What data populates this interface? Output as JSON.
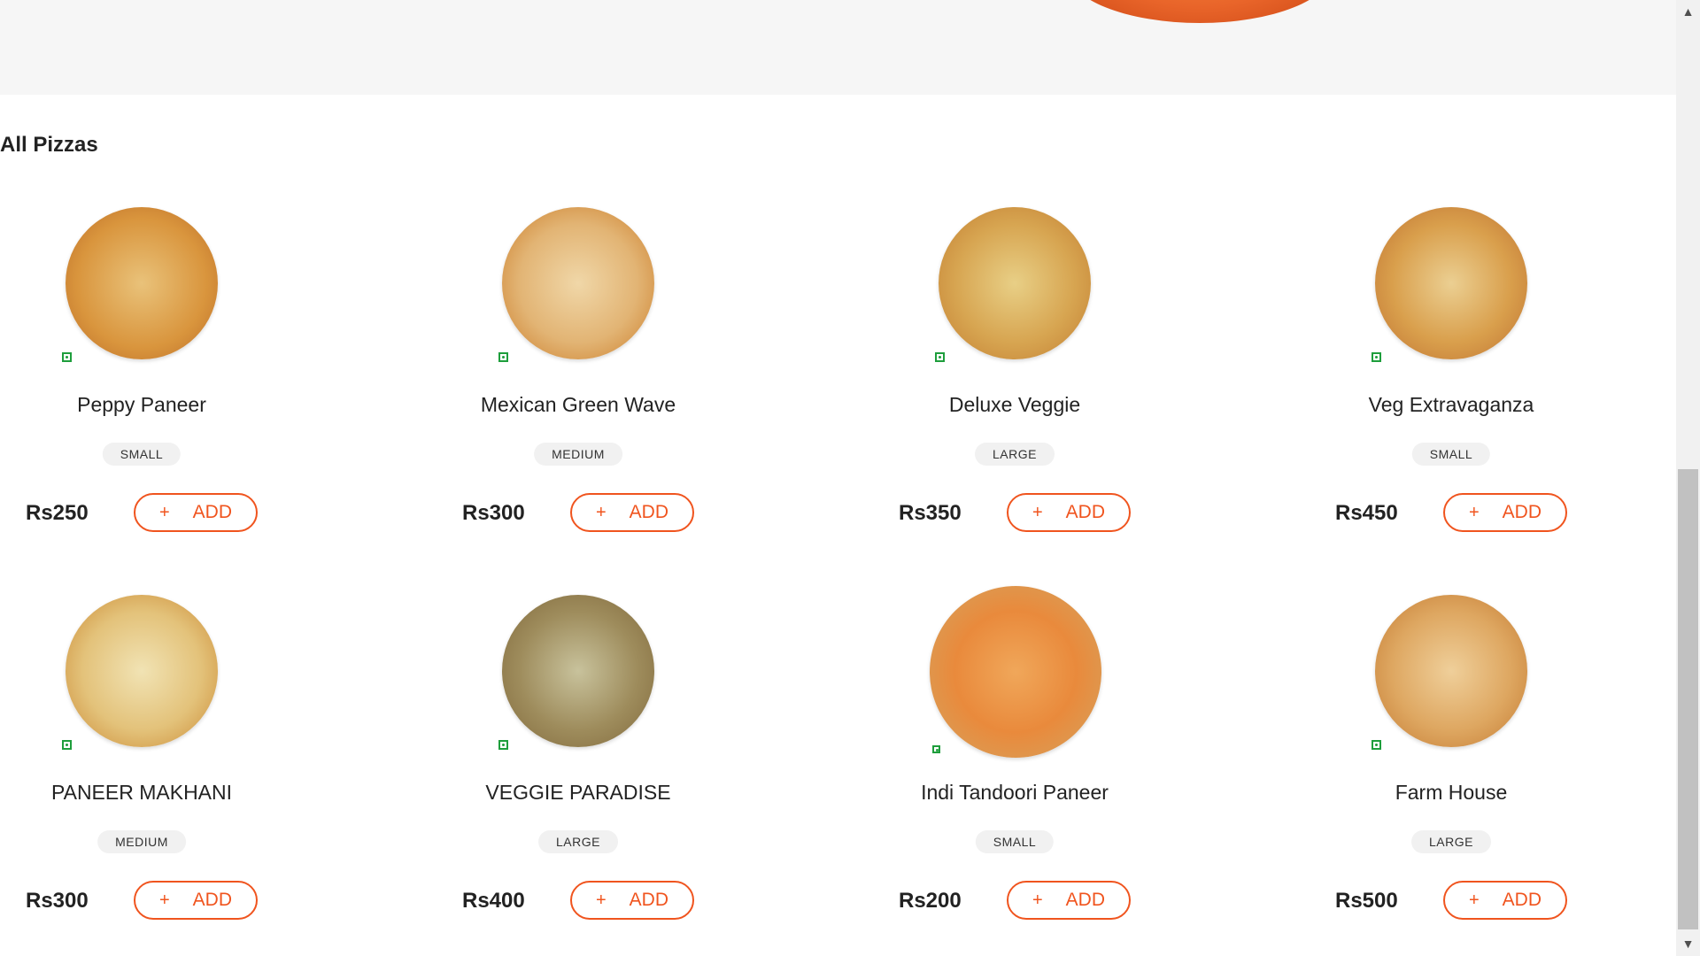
{
  "section_title": "All Pizzas",
  "veg_color": "#1e9e3c",
  "accent_color": "#f0541e",
  "pizzas": [
    {
      "name": "Peppy Paneer",
      "size": "SMALL",
      "price": "Rs250",
      "add_label": "ADD",
      "plus": "+"
    },
    {
      "name": "Mexican Green Wave",
      "size": "MEDIUM",
      "price": "Rs300",
      "add_label": "ADD",
      "plus": "+"
    },
    {
      "name": "Deluxe Veggie",
      "size": "LARGE",
      "price": "Rs350",
      "add_label": "ADD",
      "plus": "+"
    },
    {
      "name": "Veg Extravaganza",
      "size": "SMALL",
      "price": "Rs450",
      "add_label": "ADD",
      "plus": "+"
    },
    {
      "name": "PANEER MAKHANI",
      "size": "MEDIUM",
      "price": "Rs300",
      "add_label": "ADD",
      "plus": "+"
    },
    {
      "name": "VEGGIE PARADISE",
      "size": "LARGE",
      "price": "Rs400",
      "add_label": "ADD",
      "plus": "+"
    },
    {
      "name": "Indi Tandoori Paneer",
      "size": "SMALL",
      "price": "Rs200",
      "add_label": "ADD",
      "plus": "+"
    },
    {
      "name": "Farm House",
      "size": "LARGE",
      "price": "Rs500",
      "add_label": "ADD",
      "plus": "+"
    }
  ],
  "scrollbar": {
    "up_icon": "▲",
    "down_icon": "▼"
  }
}
